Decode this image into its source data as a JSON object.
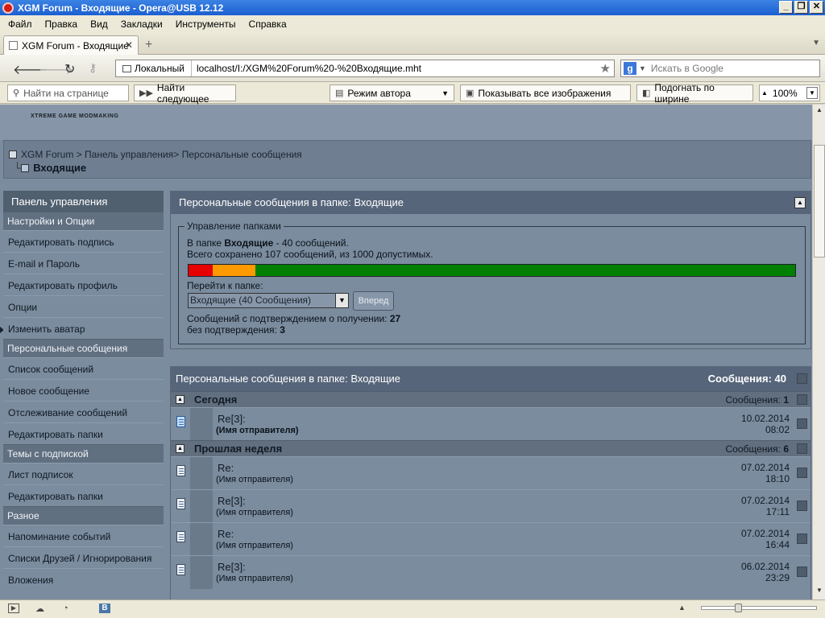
{
  "window": {
    "title": "XGM Forum - Входящие - Opera@USB 12.12",
    "controls": [
      "_",
      "❐",
      "✕"
    ]
  },
  "menu": [
    "Файл",
    "Правка",
    "Вид",
    "Закладки",
    "Инструменты",
    "Справка"
  ],
  "tab": {
    "title": "XGM Forum - Входящие",
    "close": "✕",
    "new": "+"
  },
  "address": {
    "security_label": "Локальный",
    "url": "localhost/I:/XGM%20Forum%20-%20Входящие.mht"
  },
  "search": {
    "engine": "g",
    "placeholder": "Искать в Google"
  },
  "findbar": {
    "find_placeholder": "Найти на странице",
    "find_next": "Найти следующее",
    "author_mode": "Режим автора",
    "show_images": "Показывать все изображения",
    "fit_width": "Подогнать по ширине",
    "zoom": "100%"
  },
  "site": {
    "logo": "XTREME GAME MODMAKING"
  },
  "breadcrumb": {
    "path": "XGM Forum > Панель управления> Персональные сообщения",
    "current": "Входящие"
  },
  "sidebar": {
    "title": "Панель управления",
    "sections": [
      {
        "label": "Настройки и Опции",
        "items": [
          "Редактировать подпись",
          "E-mail и Пароль",
          "Редактировать профиль",
          "Опции",
          "Изменить аватар"
        ]
      },
      {
        "label": "Персональные сообщения",
        "items": [
          "Список сообщений",
          "Новое сообщение",
          "Отслеживание сообщений",
          "Редактировать папки"
        ]
      },
      {
        "label": "Темы с подпиской",
        "items": [
          "Лист подписок",
          "Редактировать папки"
        ]
      },
      {
        "label": "Разное",
        "items": [
          "Напоминание событий",
          "Списки Друзей / Игнорирования",
          "Вложения"
        ]
      }
    ]
  },
  "folder_panel": {
    "title_prefix": "Персональные сообщения в папке",
    "title_folder": "Входящие",
    "legend": "Управление папками",
    "in_folder_prefix": "В папке",
    "in_folder_name": "Входящие",
    "in_folder_suffix": "- 40 сообщений.",
    "saved_text": "Всего сохранено 107 сообщений, из 1000 допустимых.",
    "usage": {
      "red_fraction": 0.04,
      "orange_fraction": 0.07
    },
    "goto_label": "Перейти к папке:",
    "select_value": "Входящие (40 Сообщения)",
    "go_button": "Вперед",
    "receipt_label": "Сообщений с подтверждением о получении:",
    "receipt_count": "27",
    "unconfirmed_label": "без подтверждения:",
    "unconfirmed_count": "3"
  },
  "messages": {
    "title_prefix": "Персональные сообщения в папке",
    "title_folder": "Входящие",
    "total_label": "Сообщения: 40",
    "groups": [
      {
        "label": "Сегодня",
        "count_label": "Сообщения:",
        "count": "1",
        "rows": [
          {
            "subject": "Re[3]:",
            "sender": "(Имя отправителя)",
            "date": "10.02.2014",
            "time": "08:02",
            "new": true
          }
        ]
      },
      {
        "label": "Прошлая неделя",
        "count_label": "Сообщения:",
        "count": "6",
        "rows": [
          {
            "subject": "Re:",
            "sender": "(Имя отправителя)",
            "date": "07.02.2014",
            "time": "18:10",
            "new": false
          },
          {
            "subject": "Re[3]:",
            "sender": "(Имя отправителя)",
            "date": "07.02.2014",
            "time": "17:11",
            "new": false
          },
          {
            "subject": "Re:",
            "sender": "(Имя отправителя)",
            "date": "07.02.2014",
            "time": "16:44",
            "new": false
          },
          {
            "subject": "Re[3]:",
            "sender": "(Имя отправителя)",
            "date": "06.02.2014",
            "time": "23:29",
            "new": false
          }
        ]
      }
    ]
  },
  "status": {
    "zoom_level": 0.3
  }
}
